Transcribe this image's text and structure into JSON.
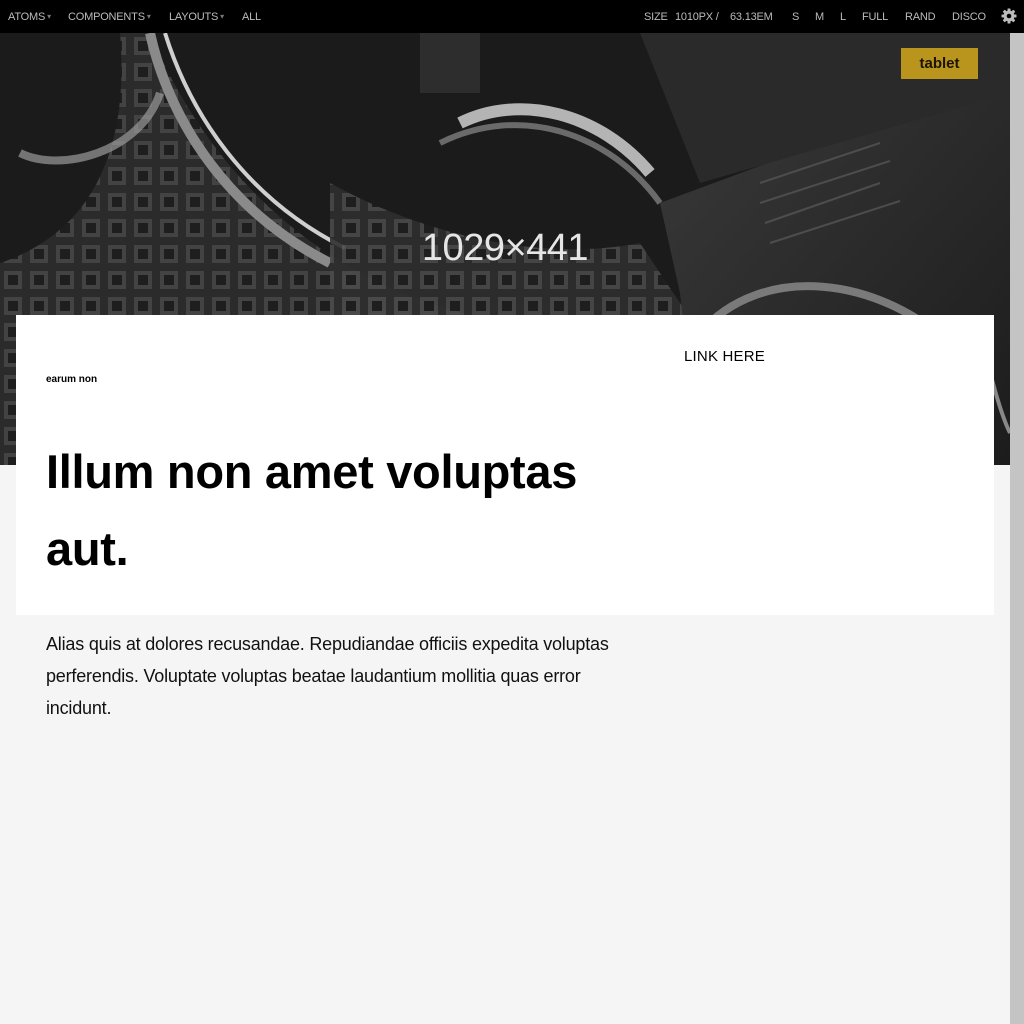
{
  "toolbar": {
    "nav": [
      {
        "label": "ATOMS",
        "dropdown": true
      },
      {
        "label": "COMPONENTS",
        "dropdown": true
      },
      {
        "label": "LAYOUTS",
        "dropdown": true
      },
      {
        "label": "ALL",
        "dropdown": false
      }
    ],
    "dropdown_glyph": "▾",
    "size_label": "SIZE",
    "size_px": "1010PX /",
    "size_em": "63.13EM",
    "size_buttons": [
      "S",
      "M",
      "L",
      "FULL",
      "RAND",
      "DISCO"
    ],
    "settings_icon": "gear-icon"
  },
  "hero": {
    "dimensions_text": "1029×441",
    "badge": "tablet",
    "badge_color": "#b9951e"
  },
  "card": {
    "eyebrow": "earum non",
    "link": "LINK HERE",
    "headline_line1": "Illum non amet voluptas",
    "headline_line2": "aut."
  },
  "body": {
    "line1": "Alias quis at dolores recusandae. Repudiandae officiis expedita voluptas",
    "line2": "perferendis. Voluptate voluptas beatae laudantium mollitia quas error",
    "line3": "incidunt."
  }
}
